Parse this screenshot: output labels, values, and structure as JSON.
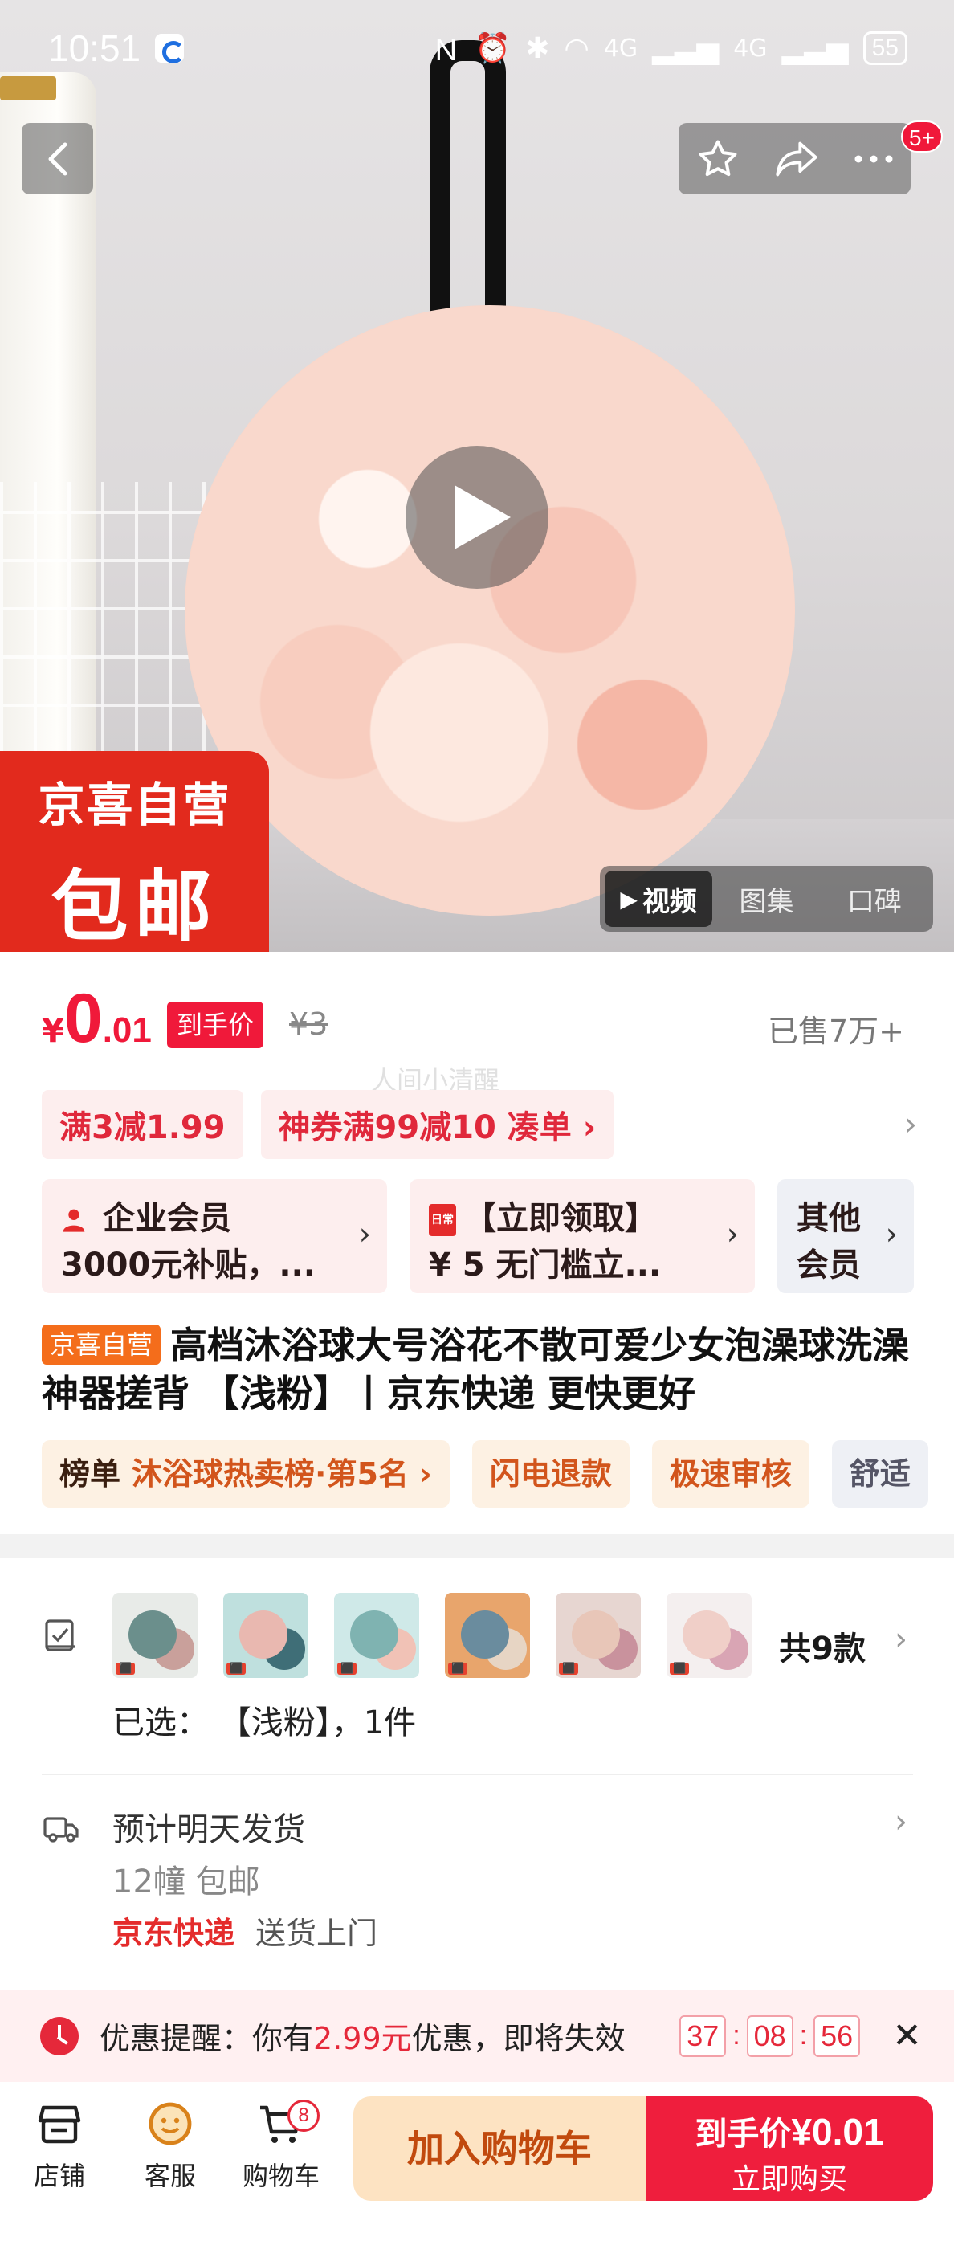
{
  "status_bar": {
    "time": "10:51",
    "net1": "4G",
    "net2": "4G",
    "battery": "55"
  },
  "header": {
    "message_badge": "5+"
  },
  "hero": {
    "badge_line1": "京喜自营",
    "badge_line2": "包邮",
    "media_tabs": [
      "视频",
      "图集",
      "口碑"
    ],
    "active_tab": "视频"
  },
  "price": {
    "currency": "¥",
    "integer": "0",
    "decimal": ".01",
    "tag": "到手价",
    "original": "¥3",
    "sold": "已售7万+",
    "watermark": "人间小清醒"
  },
  "promos": [
    {
      "label": "满3减1.99"
    },
    {
      "label": "神券满99减10  凑单 ›"
    }
  ],
  "members": [
    {
      "line1": "企业会员",
      "line2": "3000元补贴，..."
    },
    {
      "line1": "【立即领取】",
      "line2": "¥ 5  无门槛立...",
      "icon_text": "日常"
    },
    {
      "line1": "其他",
      "line2": "会员"
    }
  ],
  "product": {
    "tag": "京喜自营",
    "title": "高档沐浴球大号浴花不散可爱少女泡澡球洗澡神器搓背 【浅粉】丨京东快递 更快更好"
  },
  "tags": [
    {
      "key": "榜单",
      "value": "沐浴球热卖榜·第5名 ›"
    },
    {
      "value": "闪电退款"
    },
    {
      "value": "极速审核"
    },
    {
      "value": "舒适"
    }
  ],
  "spec": {
    "thumb_label": "已选",
    "variant_count": "共9款",
    "selected": "已选：  【浅粉】，1件",
    "ship_estimate": "预计明天发货",
    "ship_location": "12幢   包邮",
    "courier": "京东快递",
    "delivery": "送货上门"
  },
  "reminder": {
    "prefix": "优惠提醒：你有",
    "amount": "2.99元",
    "suffix": "优惠，即将失效",
    "hours": "37",
    "minutes": "08",
    "seconds": "56"
  },
  "bottom_bar": {
    "store": "店铺",
    "service": "客服",
    "cart": "购物车",
    "cart_count": "8",
    "add_to_cart": "加入购物车",
    "buy_line1": "到手价",
    "buy_price": "¥0.01",
    "buy_line2": "立即购买"
  },
  "colors": {
    "accent_red": "#f0193a",
    "brand_red": "#e22a1d",
    "cart_bg": "#fde3c2"
  }
}
